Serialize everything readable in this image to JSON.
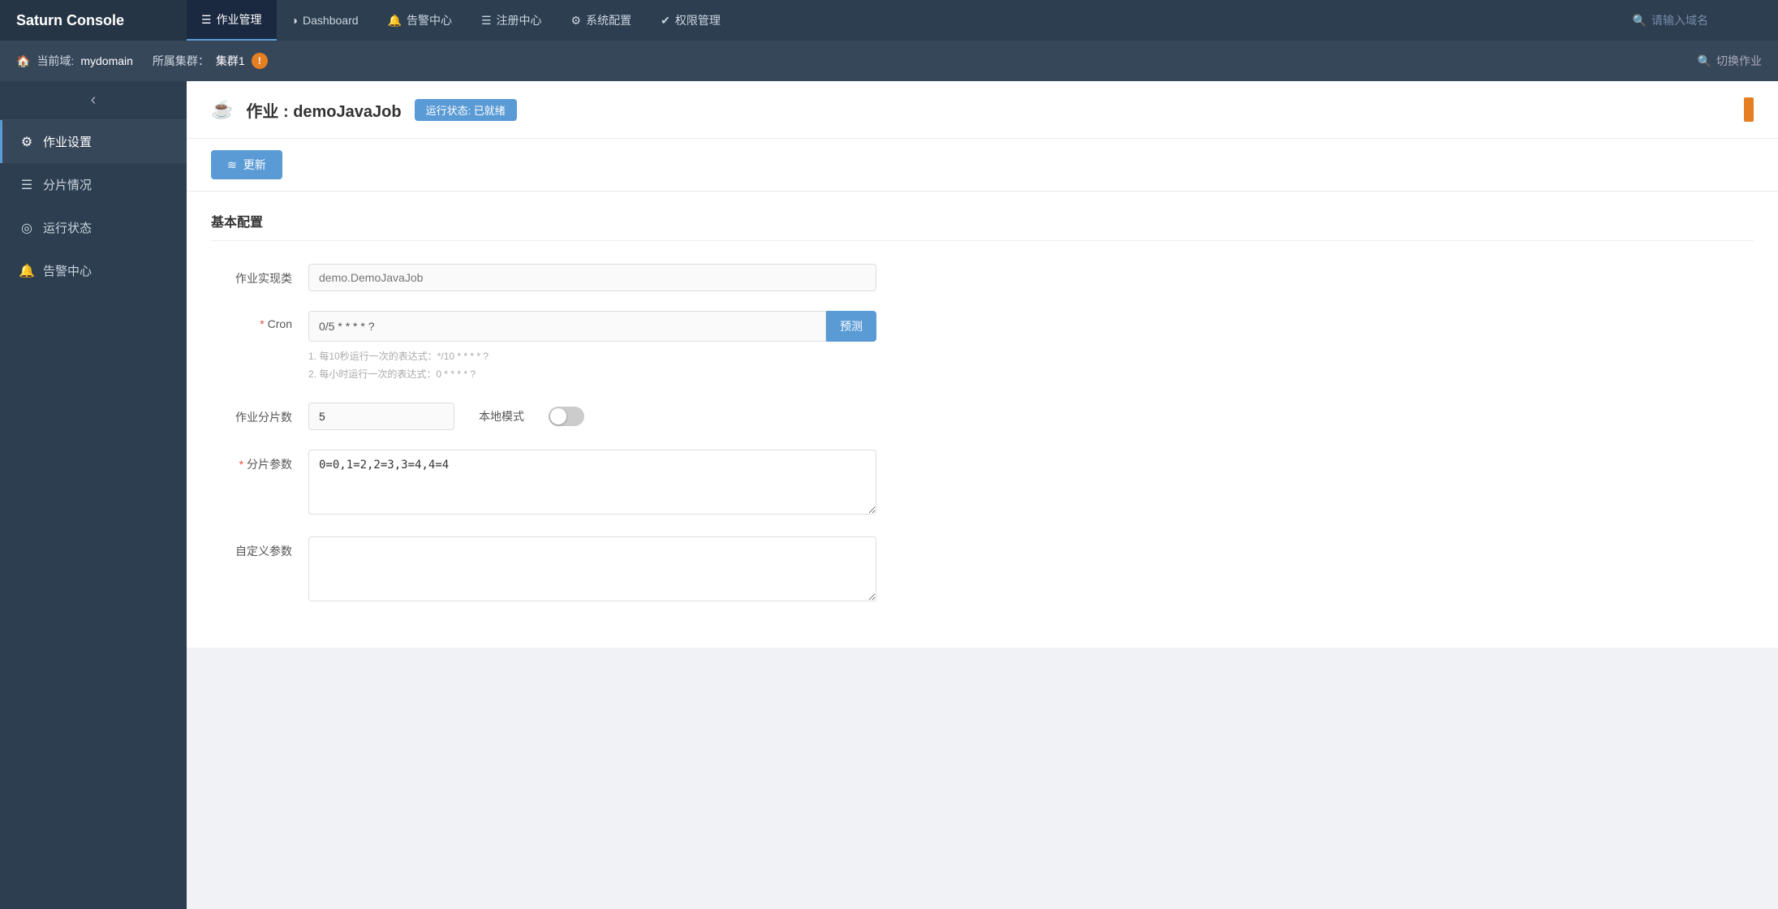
{
  "app": {
    "brand": "Saturn Console"
  },
  "top_nav": {
    "items": [
      {
        "id": "job-manage",
        "icon": "☰",
        "label": "作业管理",
        "active": true
      },
      {
        "id": "dashboard",
        "icon": "◑",
        "label": "Dashboard",
        "active": false
      },
      {
        "id": "alert-center",
        "icon": "🔔",
        "label": "告警中心",
        "active": false
      },
      {
        "id": "registry",
        "icon": "☰",
        "label": "注册中心",
        "active": false
      },
      {
        "id": "system-config",
        "icon": "⚙",
        "label": "系统配置",
        "active": false
      },
      {
        "id": "permission",
        "icon": "✔",
        "label": "权限管理",
        "active": false
      }
    ],
    "search_placeholder": "请输入域名"
  },
  "domain_bar": {
    "current_domain_label": "当前域:",
    "domain_name": "mydomain",
    "cluster_label": "所属集群：",
    "cluster_name": "集群1",
    "switch_job_label": "切换作业"
  },
  "sidebar": {
    "collapse_icon": "‹",
    "items": [
      {
        "id": "job-settings",
        "icon": "⚙",
        "label": "作业设置",
        "active": true
      },
      {
        "id": "shard-status",
        "icon": "☰",
        "label": "分片情况",
        "active": false
      },
      {
        "id": "run-status",
        "icon": "◎",
        "label": "运行状态",
        "active": false
      },
      {
        "id": "alert",
        "icon": "🔔",
        "label": "告警中心",
        "active": false
      }
    ]
  },
  "page_header": {
    "job_icon": "☕",
    "title_prefix": "作业 : ",
    "job_name": "demoJavaJob",
    "status_label": "运行状态: 已就绪"
  },
  "toolbar": {
    "update_button_icon": "≋",
    "update_button_label": "更新"
  },
  "form": {
    "section_title": "基本配置",
    "fields": {
      "job_class": {
        "label": "作业实现类",
        "value": "",
        "placeholder": "demo.DemoJavaJob",
        "required": false
      },
      "cron": {
        "label": "Cron",
        "value": "0/5 * * * * ?",
        "required": true,
        "predict_button": "预测",
        "hint1": "1. 每10秒运行一次的表达式：*/10 * * * * ?",
        "hint2": "2. 每小时运行一次的表达式：0 * * * * ?"
      },
      "shard_count": {
        "label": "作业分片数",
        "value": "5",
        "required": false
      },
      "local_mode": {
        "label": "本地模式",
        "enabled": false
      },
      "shard_params": {
        "label": "分片参数",
        "value": "0=0,1=2,2=3,3=4,4=4",
        "required": true
      },
      "custom_params": {
        "label": "自定义参数",
        "value": "",
        "required": false
      }
    }
  }
}
